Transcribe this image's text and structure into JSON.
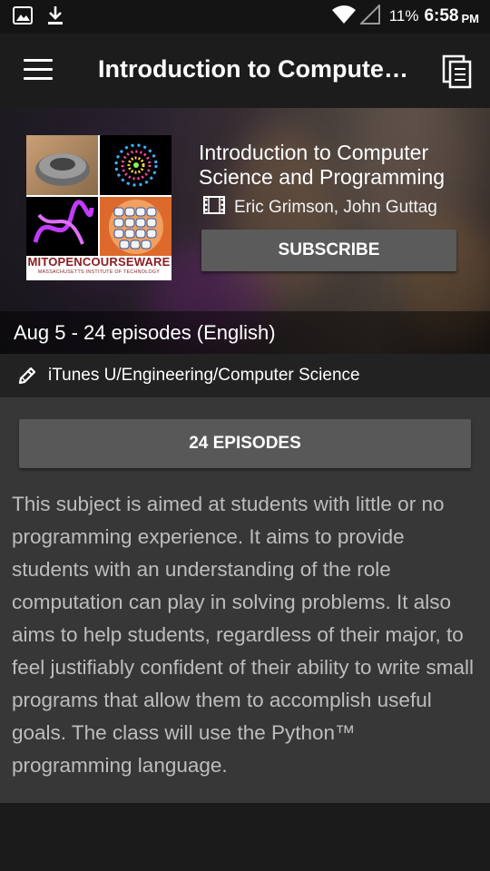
{
  "status_bar": {
    "battery": "11%",
    "time": "6:58",
    "ampm": "PM",
    "icons": [
      "image-icon",
      "download-icon",
      "wifi-icon",
      "signal-icon"
    ]
  },
  "toolbar": {
    "title": "Introduction to Computer Science and Programming",
    "icons": [
      "menu-icon",
      "copy-icon"
    ]
  },
  "podcast": {
    "title": "Introduction to Computer Science and Programming",
    "authors": "Eric Grimson, John Guttag",
    "subscribe_label": "SUBSCRIBE",
    "episodes_summary": "Aug 5 - 24 episodes (English)",
    "category": "iTunes U/Engineering/Computer Science",
    "artwork": {
      "logo_text": "MITOPENCOURSEWARE",
      "logo_subtext": "MASSACHUSETTS INSTITUTE OF TECHNOLOGY"
    }
  },
  "content": {
    "episodes_button_label": "24 EPISODES",
    "description": "This subject is aimed at students with little or no programming experience. It aims to provide students with an understanding of the role computation can play in solving problems. It also aims to help students, regardless of their major, to feel justifiably confident of their ability to write small programs that allow them to accomplish useful goals. The class will use the Python™ programming language."
  },
  "colors": {
    "toolbar_bg": "#1c1c1c",
    "content_bg": "#373737",
    "button_bg": "#585858",
    "mit_red": "#8a1e22"
  }
}
